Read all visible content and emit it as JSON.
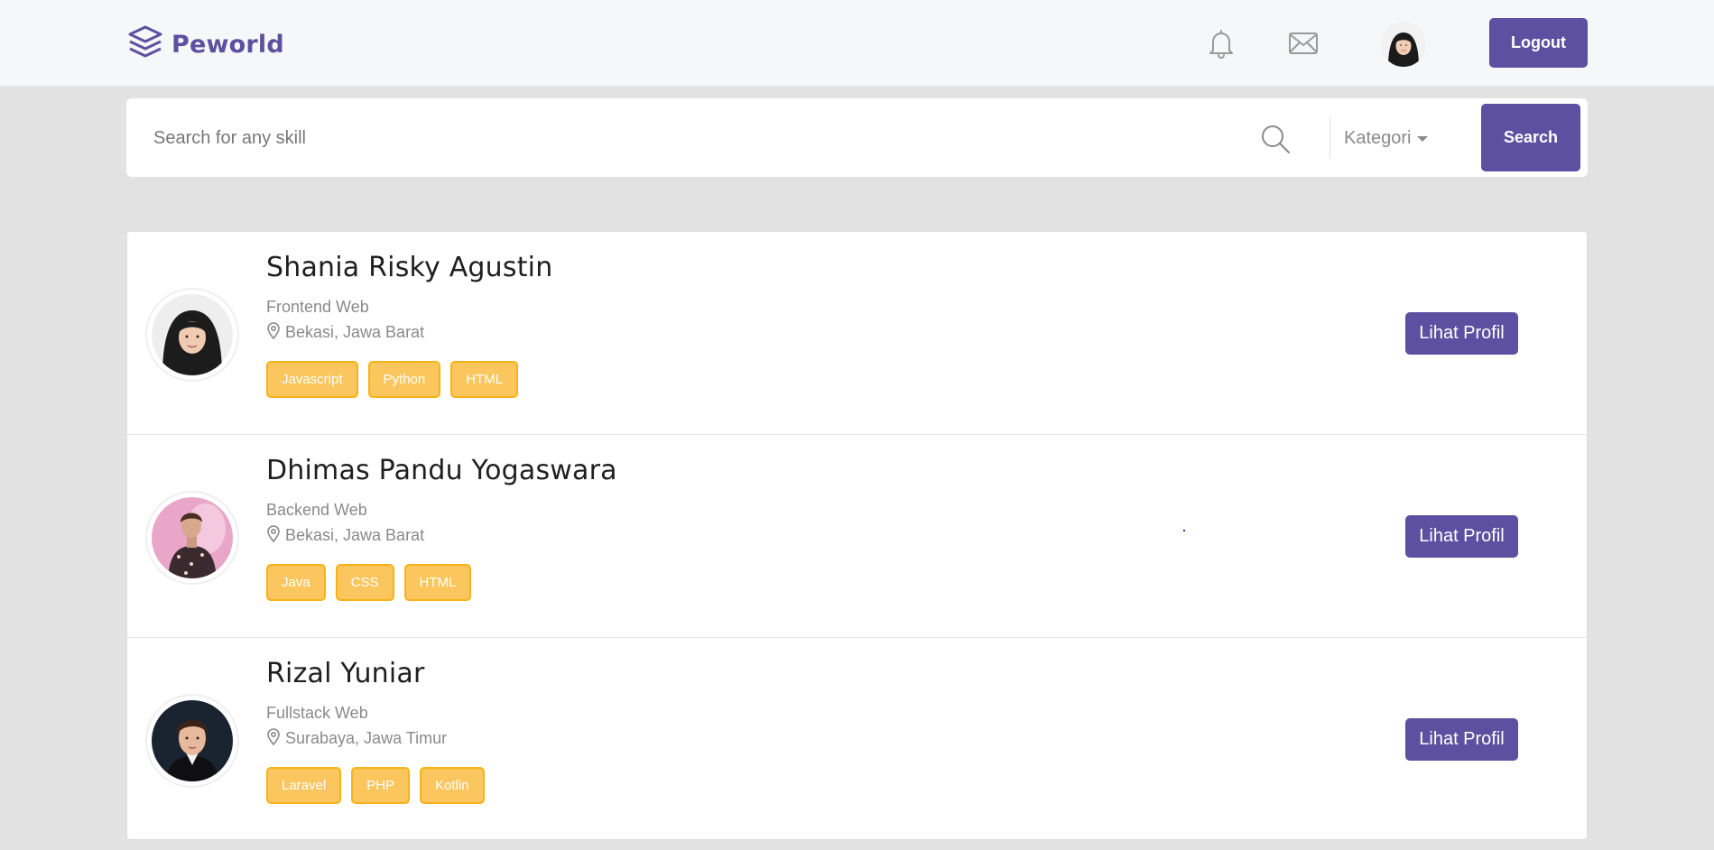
{
  "navbar": {
    "brand": "Peworld",
    "logout_label": "Logout",
    "icons": [
      "logo-layers-icon",
      "bell-icon",
      "mail-icon"
    ]
  },
  "search": {
    "placeholder": "Search for any skill",
    "value": "",
    "category_label": "Kategori",
    "button_label": "Search"
  },
  "colors": {
    "primary": "#5e50a1",
    "skill_bg": "#fbc65e",
    "skill_border": "#f7b318",
    "page_bg": "#e2e2e2"
  },
  "candidates": [
    {
      "name": "Shania Risky Agustin",
      "job": "Frontend Web",
      "location": "Bekasi, Jawa Barat",
      "skills": [
        "Javascript",
        "Python",
        "HTML"
      ],
      "button_label": "Lihat Profil"
    },
    {
      "name": "Dhimas Pandu Yogaswara",
      "job": "Backend Web",
      "location": "Bekasi, Jawa Barat",
      "skills": [
        "Java",
        "CSS",
        "HTML"
      ],
      "button_label": "Lihat Profil"
    },
    {
      "name": "Rizal Yuniar",
      "job": "Fullstack Web",
      "location": "Surabaya, Jawa Timur",
      "skills": [
        "Laravel",
        "PHP",
        "Kotlin"
      ],
      "button_label": "Lihat Profil"
    }
  ]
}
